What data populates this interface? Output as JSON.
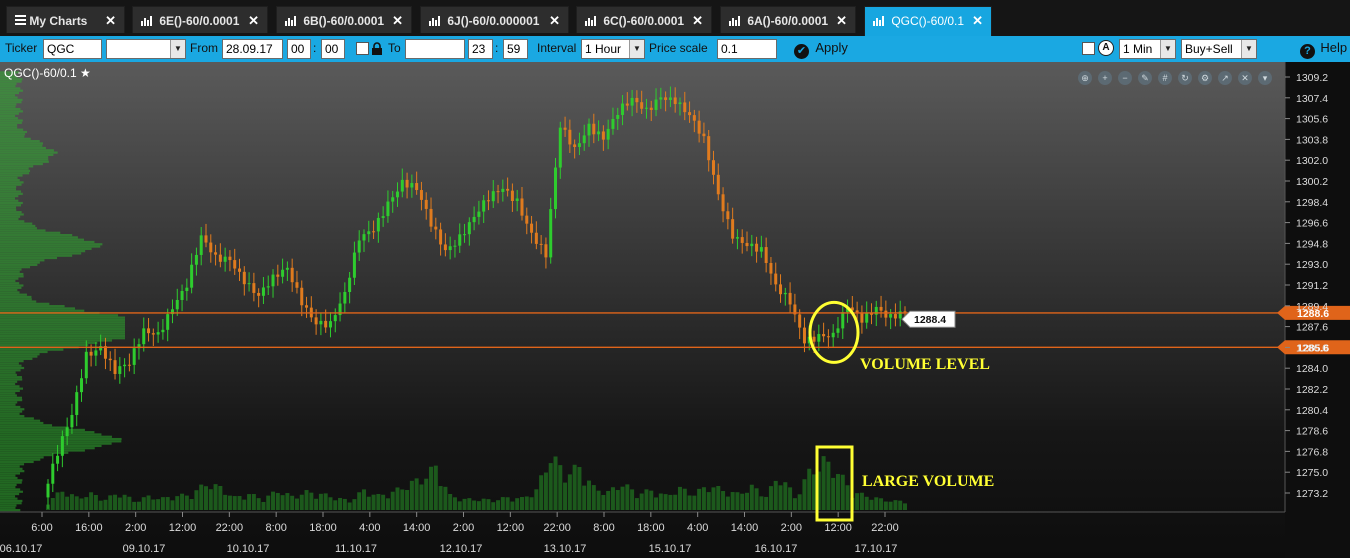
{
  "tabs": [
    {
      "label": "My Charts",
      "icon": "menu-icon"
    },
    {
      "label": "6E()-60/0.0001",
      "icon": "chart-icon"
    },
    {
      "label": "6B()-60/0.0001",
      "icon": "chart-icon"
    },
    {
      "label": "6J()-60/0.000001",
      "icon": "chart-icon"
    },
    {
      "label": "6C()-60/0.0001",
      "icon": "chart-icon"
    },
    {
      "label": "6A()-60/0.0001",
      "icon": "chart-icon"
    },
    {
      "label": "QGC()-60/0.1",
      "icon": "chart-icon",
      "active": true
    }
  ],
  "toolbar": {
    "ticker_label": "Ticker",
    "ticker_value": "QGC",
    "symbol_select": "",
    "from_label": "From",
    "from_date": "28.09.17",
    "from_hour": "00",
    "from_minute": "00",
    "time_sep": ":",
    "to_label": "To",
    "to_date": "",
    "to_hour": "23",
    "to_minute": "59",
    "interval_label": "Interval",
    "interval_value": "1 Hour",
    "price_scale_label": "Price scale",
    "price_scale_value": "0.1",
    "apply_label": "Apply",
    "timeframe_value": "1 Min",
    "side_value": "Buy+Sell",
    "help_label": "Help"
  },
  "chart": {
    "title": "QGC()-60/0.1",
    "colors": {
      "up": "#2ecc2e",
      "down": "#e07b1e",
      "level_line": "#e0641a",
      "annotation": "#ffff33",
      "profile": "#2fae2f"
    }
  },
  "chart_data": {
    "type": "candlestick",
    "title": "QGC()-60/0.1",
    "y_axis": {
      "min": 1271.4,
      "max": 1309.8,
      "tick_labels": [
        "1309.2",
        "1307.4",
        "1305.6",
        "1303.8",
        "1302.0",
        "1300.2",
        "1298.4",
        "1296.6",
        "1294.8",
        "1293.0",
        "1291.2",
        "1289.4",
        "1287.6",
        "1286.0",
        "1284.0",
        "1282.2",
        "1280.4",
        "1278.6",
        "1276.8",
        "1275.0",
        "1273.2"
      ]
    },
    "x_axis": {
      "time_labels": [
        "6:00",
        "16:00",
        "2:00",
        "12:00",
        "22:00",
        "8:00",
        "18:00",
        "4:00",
        "14:00",
        "2:00",
        "12:00",
        "22:00",
        "8:00",
        "18:00",
        "4:00",
        "14:00",
        "2:00",
        "12:00",
        "22:00"
      ],
      "date_labels": [
        "06.10.17",
        "09.10.17",
        "10.10.17",
        "11.10.17",
        "12.10.17",
        "13.10.17",
        "15.10.17",
        "16.10.17",
        "17.10.17"
      ]
    },
    "price_path": [
      [
        0,
        1272.5
      ],
      [
        3,
        1276.0
      ],
      [
        6,
        1279.5
      ],
      [
        9,
        1285.2
      ],
      [
        12,
        1286.0
      ],
      [
        15,
        1283.5
      ],
      [
        18,
        1283.8
      ],
      [
        21,
        1286.8
      ],
      [
        24,
        1287.0
      ],
      [
        27,
        1289.5
      ],
      [
        30,
        1291.0
      ],
      [
        33,
        1294.8
      ],
      [
        36,
        1293.2
      ],
      [
        39,
        1293.6
      ],
      [
        42,
        1291.8
      ],
      [
        45,
        1290.0
      ],
      [
        48,
        1291.2
      ],
      [
        51,
        1292.3
      ],
      [
        54,
        1289.9
      ],
      [
        57,
        1288.1
      ],
      [
        60,
        1287.5
      ],
      [
        63,
        1289.8
      ],
      [
        66,
        1295.0
      ],
      [
        69,
        1296.3
      ],
      [
        72,
        1298.5
      ],
      [
        75,
        1299.8
      ],
      [
        78,
        1299.0
      ],
      [
        81,
        1296.3
      ],
      [
        84,
        1294.4
      ],
      [
        87,
        1295.5
      ],
      [
        90,
        1296.8
      ],
      [
        93,
        1298.2
      ],
      [
        96,
        1299.4
      ],
      [
        99,
        1298.7
      ],
      [
        102,
        1295.8
      ],
      [
        105,
        1293.5
      ],
      [
        108,
        1304.5
      ],
      [
        111,
        1302.8
      ],
      [
        114,
        1305.3
      ],
      [
        117,
        1304.2
      ],
      [
        120,
        1305.9
      ],
      [
        123,
        1306.8
      ],
      [
        126,
        1306.2
      ],
      [
        129,
        1307.9
      ],
      [
        132,
        1307.4
      ],
      [
        135,
        1305.6
      ],
      [
        138,
        1303.3
      ],
      [
        141,
        1298.9
      ],
      [
        144,
        1295.8
      ],
      [
        147,
        1294.8
      ],
      [
        150,
        1293.8
      ],
      [
        153,
        1290.5
      ],
      [
        156,
        1289.6
      ],
      [
        159,
        1286.6
      ],
      [
        162,
        1286.8
      ],
      [
        165,
        1286.3
      ],
      [
        168,
        1288.8
      ],
      [
        171,
        1288.1
      ],
      [
        174,
        1289.5
      ],
      [
        177,
        1288.4
      ]
    ],
    "volume": [
      [
        0,
        9
      ],
      [
        3,
        22
      ],
      [
        6,
        14
      ],
      [
        9,
        18
      ],
      [
        12,
        12
      ],
      [
        15,
        20
      ],
      [
        18,
        10
      ],
      [
        21,
        15
      ],
      [
        24,
        13
      ],
      [
        27,
        16
      ],
      [
        30,
        17
      ],
      [
        33,
        30
      ],
      [
        36,
        25
      ],
      [
        39,
        14
      ],
      [
        42,
        18
      ],
      [
        45,
        12
      ],
      [
        48,
        22
      ],
      [
        51,
        15
      ],
      [
        54,
        20
      ],
      [
        57,
        18
      ],
      [
        60,
        14
      ],
      [
        63,
        10
      ],
      [
        66,
        22
      ],
      [
        69,
        16
      ],
      [
        72,
        20
      ],
      [
        75,
        28
      ],
      [
        78,
        35
      ],
      [
        81,
        48
      ],
      [
        84,
        16
      ],
      [
        87,
        12
      ],
      [
        90,
        12
      ],
      [
        93,
        11
      ],
      [
        96,
        14
      ],
      [
        99,
        13
      ],
      [
        102,
        22
      ],
      [
        105,
        62
      ],
      [
        108,
        40
      ],
      [
        111,
        48
      ],
      [
        114,
        25
      ],
      [
        117,
        20
      ],
      [
        120,
        30
      ],
      [
        123,
        18
      ],
      [
        126,
        22
      ],
      [
        129,
        16
      ],
      [
        132,
        24
      ],
      [
        135,
        18
      ],
      [
        138,
        28
      ],
      [
        141,
        22
      ],
      [
        144,
        18
      ],
      [
        147,
        26
      ],
      [
        150,
        16
      ],
      [
        153,
        40
      ],
      [
        156,
        14
      ],
      [
        159,
        42
      ],
      [
        162,
        55
      ],
      [
        165,
        43
      ],
      [
        168,
        20
      ],
      [
        171,
        16
      ],
      [
        174,
        12
      ],
      [
        177,
        10
      ]
    ],
    "volume_profile_peaks": [
      {
        "price": 1294.5,
        "strength": 0.8
      },
      {
        "price": 1288.0,
        "strength": 0.95
      },
      {
        "price": 1286.5,
        "strength": 0.85
      },
      {
        "price": 1277.5,
        "strength": 1.0
      },
      {
        "price": 1302.5,
        "strength": 0.35
      }
    ],
    "levels": [
      {
        "price": 1288.6,
        "label": "1288.6"
      },
      {
        "price": 1285.6,
        "label": "1285.6"
      }
    ],
    "last_price_label": "1288.4",
    "annotations": [
      {
        "text": "VOLUME LEVEL",
        "shape": "ellipse"
      },
      {
        "text": "LARGE VOLUME",
        "shape": "rectangle"
      }
    ]
  }
}
